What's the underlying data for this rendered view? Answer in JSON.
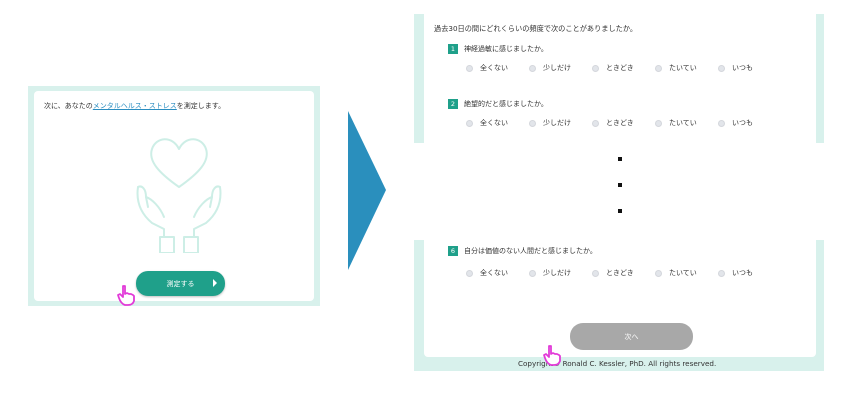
{
  "left_panel": {
    "intro_prefix": "次に、あなたの",
    "intro_link": "メンタルヘルス・ストレス",
    "intro_suffix": "を測定します。",
    "measure_button": "測定する"
  },
  "right_panel": {
    "header": "過去30日の間にどれくらいの頻度で次のことがありましたか。",
    "questions": [
      {
        "num": "1",
        "text": "神経過敏に感じましたか。"
      },
      {
        "num": "2",
        "text": "絶望的だと感じましたか。"
      },
      {
        "num": "6",
        "text": "自分は価値のない人間だと感じましたか。"
      }
    ],
    "options": [
      "全くない",
      "少しだけ",
      "ときどき",
      "たいてい",
      "いつも"
    ],
    "next_button": "次へ",
    "copyright": "Copyright© Ronald C. Kessler, PhD. All rights reserved."
  },
  "colors": {
    "accent": "#1fa08a",
    "frame": "#d8f1ec",
    "arrow": "#2a8fbd",
    "cursor": "#e23ad8",
    "disabled_button": "#a8a8a8"
  },
  "icons": [
    "heart-hands-illustration",
    "pointer-hand-icon",
    "chevron-right-icon",
    "radio-icon"
  ]
}
